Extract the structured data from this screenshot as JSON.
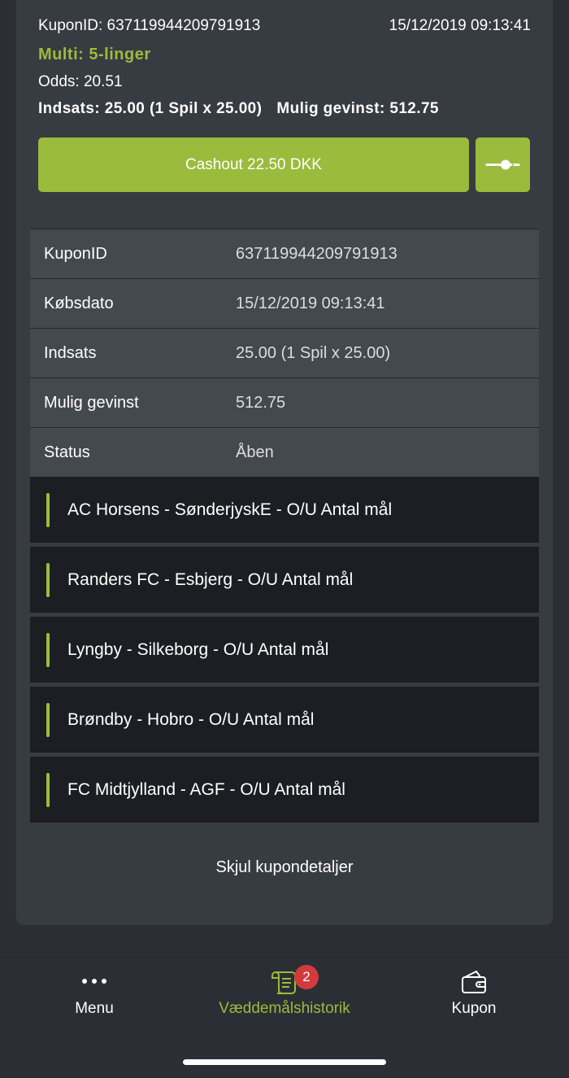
{
  "coupon": {
    "id_line": "KuponID: 637119944209791913",
    "date": "15/12/2019 09:13:41",
    "type": "Multi: 5-linger",
    "odds": "Odds: 20.51",
    "stake_line": "Indsats: 25.00 (1 Spil x 25.00)",
    "gain_line": "Mulig gevinst: 512.75",
    "cashout_label": "Cashout 22.50 DKK"
  },
  "details": [
    {
      "label": "KuponID",
      "value": "637119944209791913"
    },
    {
      "label": "Købsdato",
      "value": "15/12/2019 09:13:41"
    },
    {
      "label": "Indsats",
      "value": "25.00 (1 Spil x 25.00)"
    },
    {
      "label": "Mulig gevinst",
      "value": "512.75"
    },
    {
      "label": "Status",
      "value": "Åben"
    }
  ],
  "legs": [
    "AC Horsens - SønderjyskE - O/U Antal mål",
    "Randers FC - Esbjerg - O/U Antal mål",
    "Lyngby - Silkeborg - O/U Antal mål",
    "Brøndby - Hobro - O/U Antal mål",
    "FC Midtjylland - AGF - O/U Antal mål"
  ],
  "hide_details_label": "Skjul kupondetaljer",
  "nav": {
    "menu_label": "Menu",
    "history_label": "Væddemålshistorik",
    "history_badge": "2",
    "coupon_label": "Kupon"
  },
  "colors": {
    "accent": "#9bbb3c",
    "background": "#2b2f35",
    "card": "#373b42",
    "detail_row": "#44484f",
    "leg_row": "#1c1e24",
    "badge": "#d23b3b"
  },
  "icons": {
    "cashout_slider": "slider-toggle-icon",
    "menu": "dots-icon",
    "history": "scroll-icon",
    "coupon": "wallet-icon"
  }
}
